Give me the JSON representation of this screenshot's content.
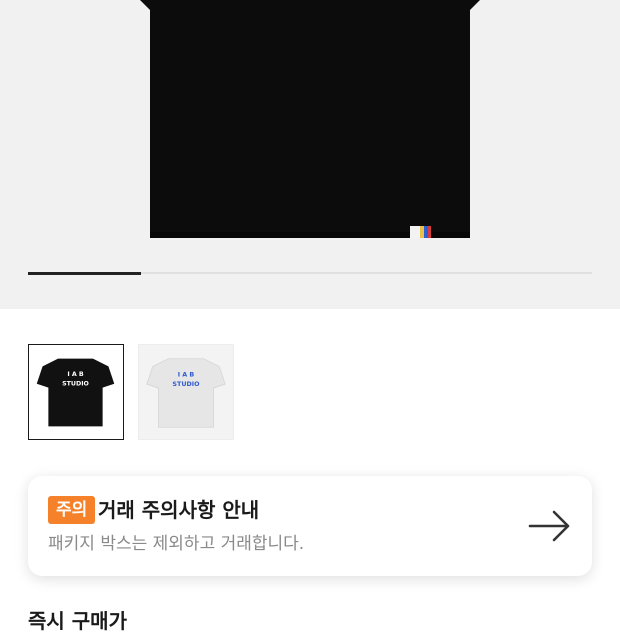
{
  "gallery": {
    "image_count": 5,
    "current_index": 1,
    "thumbnails": [
      {
        "color": "#111111",
        "print_color": "#ffffff",
        "print_line1": "I A B",
        "print_line2": "STUDIO",
        "selected": true
      },
      {
        "color": "#e6e6e6",
        "print_color": "#2f5bd1",
        "print_line1": "I A B",
        "print_line2": "STUDIO",
        "selected": false
      }
    ]
  },
  "notice": {
    "badge": "주의",
    "title": "거래 주의사항 안내",
    "subtitle": "패키지 박스는 제외하고 거래합니다.",
    "badge_color": "#f5822a"
  },
  "next_section": {
    "title": "즉시 구매가"
  }
}
